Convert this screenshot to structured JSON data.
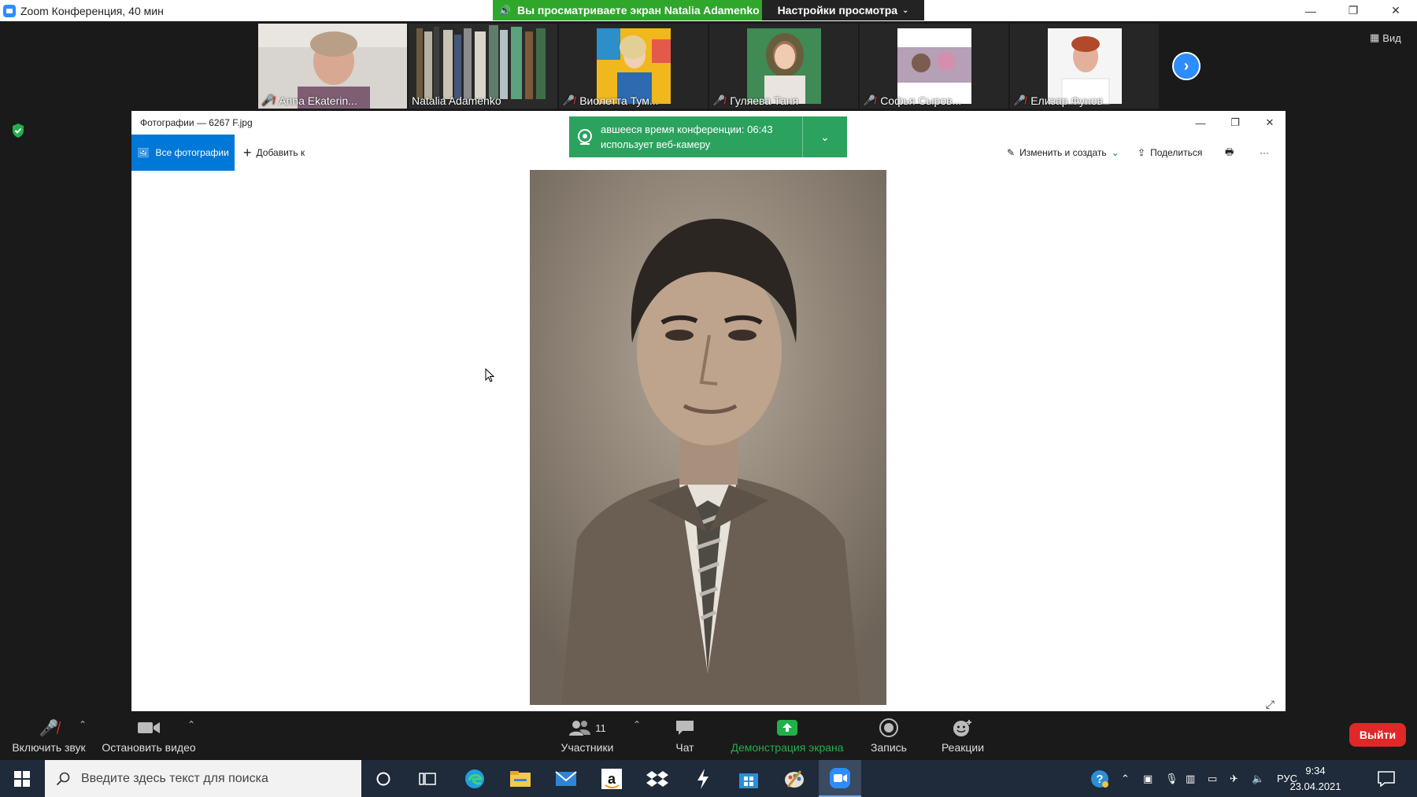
{
  "window": {
    "title": "Zoom Конференция, 40 мин",
    "minimize": "—",
    "restore": "❐",
    "close": "✕"
  },
  "share_banner": {
    "text": "Вы просматриваете экран Natalia Adamenko",
    "view_settings": "Настройки просмотра"
  },
  "participants_strip": [
    {
      "name": "Anna Ekaterin...",
      "muted": true
    },
    {
      "name": "Natalia Adamenko",
      "muted": false
    },
    {
      "name": "Виолетта Тум...",
      "muted": true
    },
    {
      "name": "Гуляева Таня",
      "muted": true
    },
    {
      "name": "Софья Сыров...",
      "muted": true
    },
    {
      "name": "Елизар Фунов",
      "muted": true
    }
  ],
  "view_button": "Вид",
  "photos_app": {
    "title": "Фотографии — 6267 F.jpg",
    "all_photos": "Все фотографии",
    "add_to": "Добавить к",
    "edit_create": "Изменить и создать",
    "share": "Поделиться",
    "more": "···"
  },
  "toast": {
    "line1": "авшееся время конференции: 06:43",
    "line2": "использует веб-камеру"
  },
  "controls": {
    "unmute": "Включить звук",
    "stop_video": "Остановить видео",
    "participants": "Участники",
    "participants_count": "11",
    "chat": "Чат",
    "share_screen": "Демонстрация экрана",
    "record": "Запись",
    "reactions": "Реакции",
    "leave": "Выйти"
  },
  "taskbar": {
    "search_placeholder": "Введите здесь текст для поиска",
    "language": "РУС",
    "time": "9:34",
    "date": "23.04.2021"
  },
  "colors": {
    "zoom_blue": "#2d8cff",
    "share_green": "#2ea72a",
    "leave_red": "#e02828",
    "photos_accent": "#0078d7",
    "toast_green": "#2ca25f"
  }
}
